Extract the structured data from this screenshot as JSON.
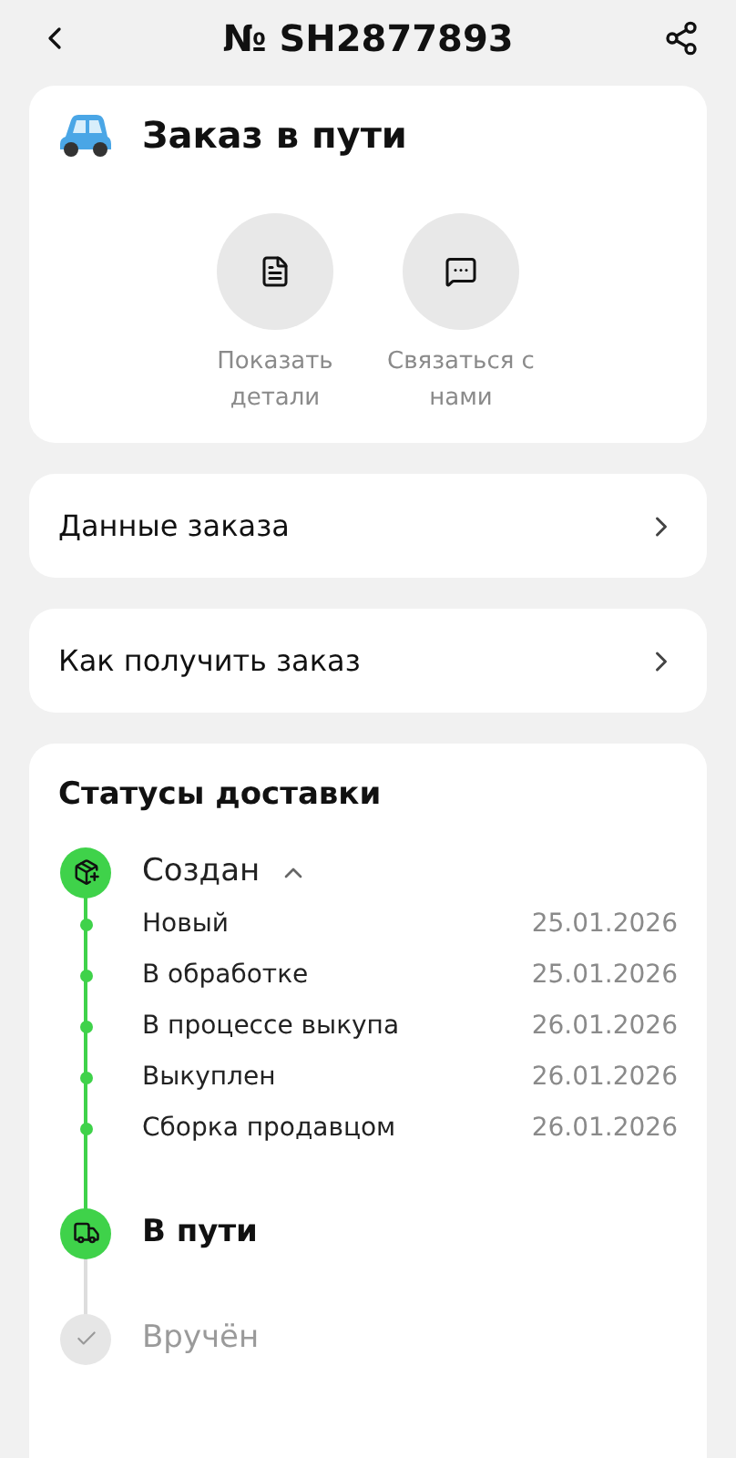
{
  "header": {
    "title": "№ SH2877893"
  },
  "summary": {
    "title": "Заказ в пути",
    "actions": [
      {
        "kind": "details",
        "label": "Показать детали"
      },
      {
        "kind": "chat",
        "label": "Связаться с нами"
      }
    ]
  },
  "links": [
    {
      "label": "Данные заказа"
    },
    {
      "label": "Как получить заказ"
    }
  ],
  "delivery": {
    "title": "Статусы доставки",
    "stages": [
      {
        "kind": "box",
        "label": "Создан",
        "completed": true,
        "current": false,
        "expanded": true,
        "children": [
          {
            "label": "Новый",
            "date": "25.01.2026"
          },
          {
            "label": "В обработке",
            "date": "25.01.2026"
          },
          {
            "label": "В процессе выкупа",
            "date": "26.01.2026"
          },
          {
            "label": "Выкуплен",
            "date": "26.01.2026"
          },
          {
            "label": "Сборка продавцом",
            "date": "26.01.2026"
          }
        ]
      },
      {
        "kind": "truck",
        "label": "В пути",
        "completed": true,
        "current": true
      },
      {
        "kind": "check",
        "label": "Вручён",
        "completed": false,
        "current": false
      }
    ]
  }
}
